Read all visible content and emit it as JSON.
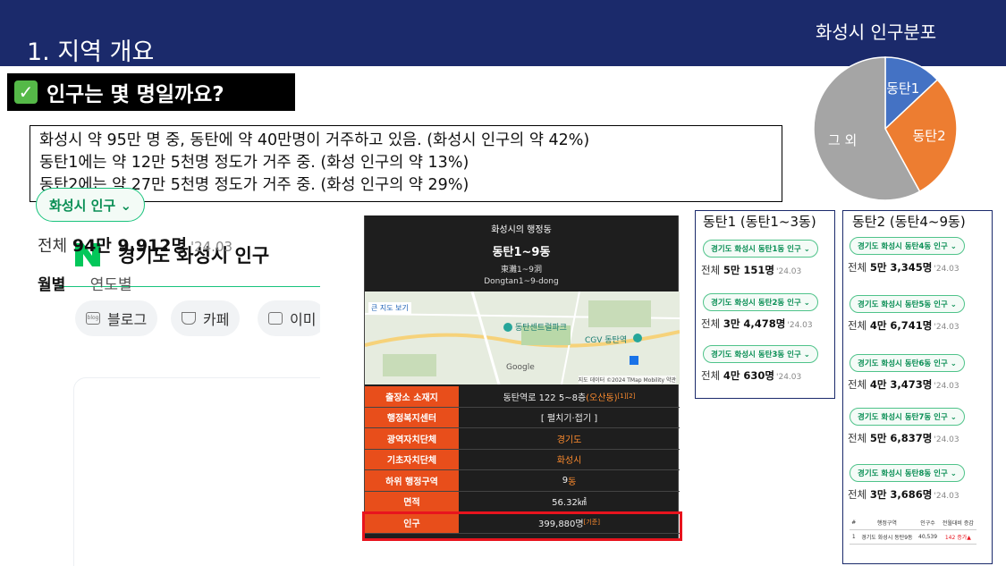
{
  "header": {
    "title": "1. 지역 개요",
    "pie_title": "화성시 인구분포"
  },
  "question": {
    "text": "인구는 몇 명일까요?",
    "check_glyph": "✓"
  },
  "summary": {
    "line1": "화성시 약 95만 명 중, 동탄에 약 40만명이 거주하고 있음. (화성시 인구의 약 42%)",
    "line2": "동탄1에는 약 12만 5천명 정도가 거주 중. (화성 인구의 약 13%)",
    "line3": "동탄2에는 약 27만 5천명 정도가 거주 중. (화성 인구의 약 29%)"
  },
  "chart_data": {
    "type": "pie",
    "title": "화성시 인구분포",
    "categories": [
      "동탄1",
      "동탄2",
      "그 외"
    ],
    "values": [
      13,
      29,
      58
    ],
    "colors": [
      "#4472c4",
      "#ed7d31",
      "#a5a5a5"
    ]
  },
  "naver": {
    "logo": "N",
    "title": "경기도 화성시 인구",
    "chips": [
      "블로그",
      "카페",
      "이미"
    ],
    "pill": "화성시 인구 ⌄",
    "total_prefix": "전체 ",
    "total_value": "94만 9,912명",
    "total_date": "'24.03",
    "tab_active": "월별",
    "tab_other": "연도별"
  },
  "wiki": {
    "heading": "화성시의 행정동",
    "name": "동탄1~9동",
    "hanja": "東灘1~9洞",
    "roman": "Dongtan1~9-dong",
    "map_link": "큰 지도 보기",
    "map_place1": "동탄센트럴파크",
    "map_place2": "CGV 동탄역",
    "map_credit": "지도 데이터 ©2024 TMap Mobility   약관",
    "map_google": "Google",
    "rows": [
      {
        "key": "출장소 소재지",
        "value": "동탄역로 122 5~8층 ",
        "link": "(오산동)",
        "sup": "[1][2]"
      },
      {
        "key": "행정복지센터",
        "value": "[ 펼치기·접기 ]"
      },
      {
        "key": "광역자치단체",
        "value": "",
        "link": "경기도"
      },
      {
        "key": "기초자치단체",
        "value": "",
        "link": "화성시"
      },
      {
        "key": "하위 행정구역",
        "value": "9",
        "link": "동"
      },
      {
        "key": "면적",
        "value": "56.32㎢"
      },
      {
        "key": "인구",
        "value": "399,880명",
        "sup": "[기준]"
      }
    ]
  },
  "dongtan1": {
    "title": "동탄1 (동탄1~3동)",
    "items": [
      {
        "pill": "경기도 화성시 동탄1동 인구 ⌄",
        "prefix": "전체 ",
        "value": "5만 151명",
        "date": "'24.03"
      },
      {
        "pill": "경기도 화성시 동탄2동 인구 ⌄",
        "prefix": "전체 ",
        "value": "3만 4,478명",
        "date": "'24.03"
      },
      {
        "pill": "경기도 화성시 동탄3동 인구 ⌄",
        "prefix": "전체 ",
        "value": "4만 630명",
        "date": "'24.03"
      }
    ]
  },
  "dongtan2": {
    "title": "동탄2 (동탄4~9동)",
    "items": [
      {
        "pill": "경기도 화성시 동탄4동 인구 ⌄",
        "prefix": "전체 ",
        "value": "5만 3,345명",
        "date": "'24.03"
      },
      {
        "pill": "경기도 화성시 동탄5동 인구 ⌄",
        "prefix": "전체 ",
        "value": "4만 6,741명",
        "date": "'24.03"
      },
      {
        "pill": "경기도 화성시 동탄6동 인구 ⌄",
        "prefix": "전체 ",
        "value": "4만 3,473명",
        "date": "'24.03"
      },
      {
        "pill": "경기도 화성시 동탄7동 인구 ⌄",
        "prefix": "전체 ",
        "value": "5만 6,837명",
        "date": "'24.03"
      },
      {
        "pill": "경기도 화성시 동탄8동 인구 ⌄",
        "prefix": "전체 ",
        "value": "3만 3,686명",
        "date": "'24.03"
      }
    ],
    "table": {
      "headers": [
        "#",
        "행정구역",
        "인구수",
        "전월대비 증감"
      ],
      "row": [
        "1",
        "경기도 화성시 동탄9동",
        "40,539",
        "142 증가▲"
      ]
    }
  },
  "colors": {
    "navy": "#1b2a6b",
    "orange": "#e84e1b",
    "green": "#19c37d",
    "red_box": "#e8141e"
  }
}
